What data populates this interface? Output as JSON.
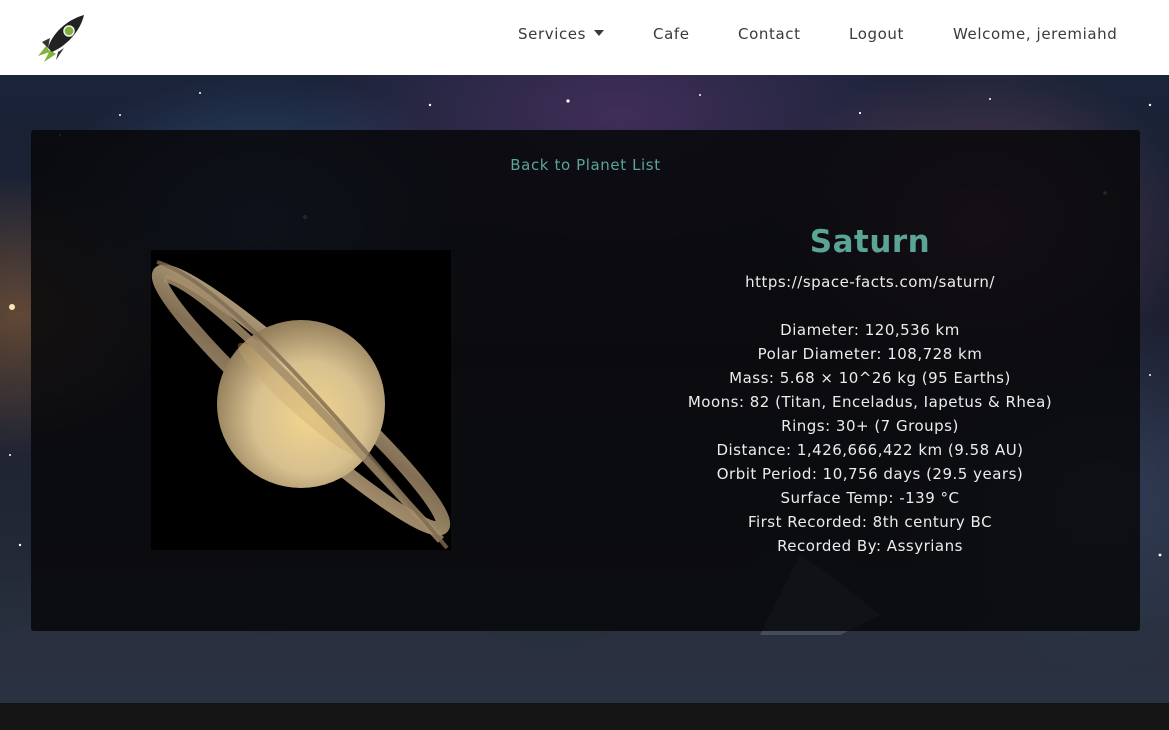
{
  "nav": {
    "services_label": "Services",
    "cafe_label": "Cafe",
    "contact_label": "Contact",
    "logout_label": "Logout",
    "welcome_text": "Welcome, jeremiahd"
  },
  "icons": {
    "logo": "rocket-icon",
    "services_dropdown": "caret-down-icon"
  },
  "colors": {
    "accent": "#5aa596",
    "card_background": "#08080a",
    "navbar_background": "#ffffff"
  },
  "back_link": "Back to Planet List",
  "planet": {
    "name": "Saturn",
    "url": "https://space-facts.com/saturn/",
    "facts": [
      "Diameter: 120,536 km",
      "Polar Diameter: 108,728 km",
      "Mass: 5.68 × 10^26 kg (95 Earths)",
      "Moons: 82 (Titan, Enceladus, Iapetus & Rhea)",
      "Rings: 30+ (7 Groups)",
      "Distance: 1,426,666,422 km (9.58 AU)",
      "Orbit Period: 10,756 days (29.5 years)",
      "Surface Temp: -139 °C",
      "First Recorded: 8th century BC",
      "Recorded By: Assyrians"
    ]
  }
}
